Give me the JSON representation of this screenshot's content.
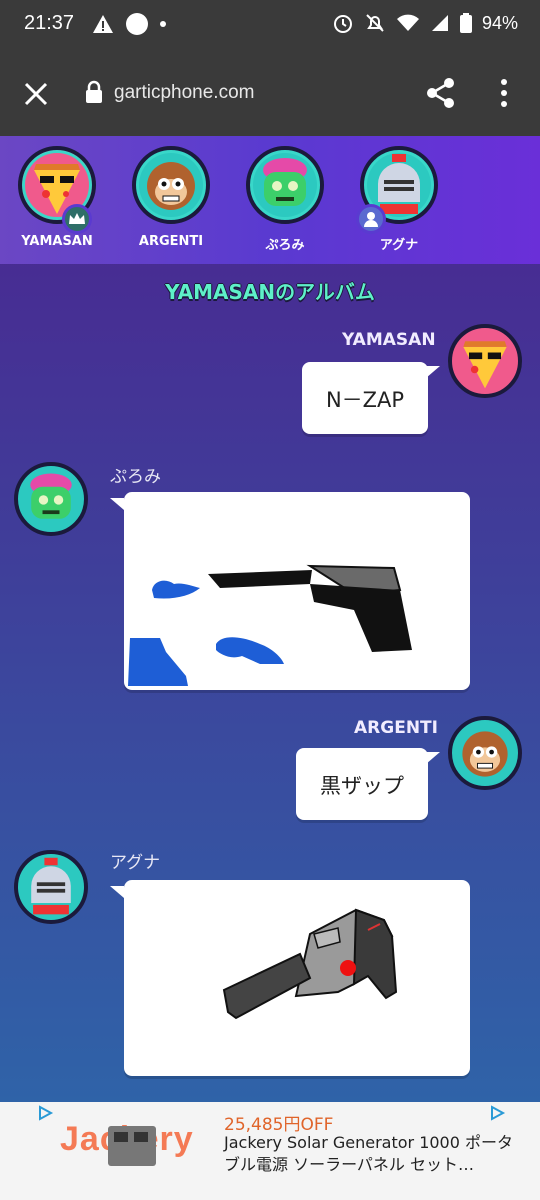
{
  "status_bar": {
    "time": "21:37",
    "battery": "94%"
  },
  "browser": {
    "url": "garticphone.com"
  },
  "players": [
    {
      "name": "YAMASAN"
    },
    {
      "name": "ARGENTI"
    },
    {
      "name": "ぷろみ"
    },
    {
      "name": "アグナ"
    }
  ],
  "album": {
    "title": "YAMASANのアルバム"
  },
  "messages": [
    {
      "author": "YAMASAN",
      "text": "N－ZAP"
    },
    {
      "author": "ぷろみ"
    },
    {
      "author": "ARGENTI",
      "text": "黒ザップ"
    },
    {
      "author": "アグナ"
    }
  ],
  "ad": {
    "logo": "Jackery",
    "price": "25,485円OFF",
    "description": "Jackery Solar Generator 1000 ポータブル電源 ソーラーパネル セット…"
  },
  "colors": {
    "accent_teal": "#5ef0c9",
    "header_purple": "#5a3ad0",
    "ad_price": "#e0642a"
  }
}
